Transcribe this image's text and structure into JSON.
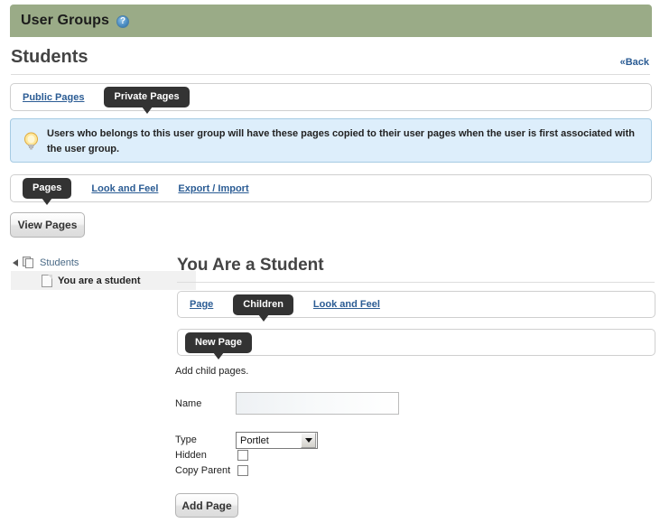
{
  "titlebar": {
    "title": "User Groups",
    "help_icon": "help-circle-icon",
    "help_glyph": "?",
    "background": "#9aab87"
  },
  "header": {
    "page_title": "Students",
    "back_label": "«Back"
  },
  "scope_tabs": {
    "items": [
      {
        "label": "Public Pages",
        "active": false
      },
      {
        "label": "Private Pages",
        "active": true
      }
    ]
  },
  "notice": {
    "icon": "lightbulb-icon",
    "text": "Users who belongs to this user group will have these pages copied to their user pages when the user is first associated with the user group.",
    "background": "#ddeefb",
    "border": "#a6cbe3"
  },
  "section_tabs": {
    "items": [
      {
        "label": "Pages",
        "active": true
      },
      {
        "label": "Look and Feel",
        "active": false
      },
      {
        "label": "Export / Import",
        "active": false
      }
    ]
  },
  "toolbar": {
    "view_pages_label": "View Pages"
  },
  "tree": {
    "root": {
      "label": "Students",
      "icon": "stacked-pages-icon",
      "expanded": true,
      "toggle_icon": "triangle-collapse-icon"
    },
    "children": [
      {
        "label": "You are a student",
        "icon": "page-icon",
        "selected": true
      }
    ]
  },
  "content": {
    "title": "You Are a Student",
    "tabs": [
      {
        "label": "Page",
        "active": false
      },
      {
        "label": "Children",
        "active": true
      },
      {
        "label": "Look and Feel",
        "active": false
      }
    ],
    "action_tabs": [
      {
        "label": "New Page",
        "active": true
      }
    ],
    "form": {
      "note": "Add child pages.",
      "name_label": "Name",
      "name_value": "",
      "name_placeholder": "",
      "type_label": "Type",
      "type_value": "Portlet",
      "type_options": [
        "Portlet"
      ],
      "hidden_label": "Hidden",
      "hidden_checked": false,
      "copy_parent_label": "Copy Parent",
      "copy_parent_checked": false,
      "submit_label": "Add Page"
    }
  },
  "colors": {
    "accent_link": "#2b5c94",
    "active_tab_bg": "#333333",
    "title_bar": "#9aab87",
    "notice_bg": "#ddeefb"
  }
}
